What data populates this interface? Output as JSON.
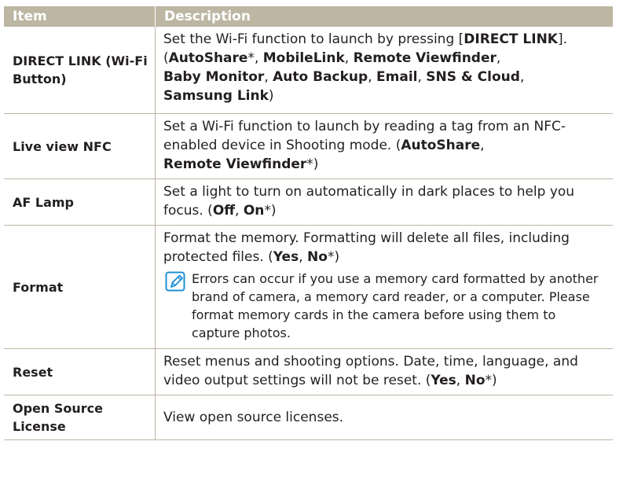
{
  "header": {
    "item": "Item",
    "description": "Description"
  },
  "rows": [
    {
      "item": "DIRECT LINK (Wi-Fi Button)",
      "desc": {
        "t1": "Set the Wi-Fi function to launch by pressing [",
        "b1": "DIRECT LINK",
        "t2": "]. (",
        "b2": "AutoShare",
        "t3": "*, ",
        "b3": "MobileLink",
        "t4": ", ",
        "b4": "Remote Viewfinder",
        "t5": ", ",
        "b5": "Baby Monitor",
        "t6": ", ",
        "b6": "Auto Backup",
        "t7": ", ",
        "b7": "Email",
        "t8": ", ",
        "b8": "SNS & Cloud",
        "t9": ", ",
        "b9": "Samsung Link",
        "t10": ")"
      }
    },
    {
      "item": "Live view NFC",
      "desc": {
        "t1": "Set a Wi-Fi function to launch by reading a tag from an NFC-enabled device in Shooting mode. (",
        "b1": "AutoShare",
        "t2": ", ",
        "b2": "Remote Viewfinder",
        "t3": "*)"
      }
    },
    {
      "item": "AF Lamp",
      "desc": {
        "t1": "Set a light to turn on automatically in dark places to help you focus. (",
        "b1": "Off",
        "t2": ", ",
        "b2": "On",
        "t3": "*)"
      }
    },
    {
      "item": "Format",
      "desc": {
        "t1": "Format the memory. Formatting will delete all files, including protected files. (",
        "b1": "Yes",
        "t2": ", ",
        "b2": "No",
        "t3": "*)"
      },
      "note": "Errors can occur if you use a memory card formatted by another brand of camera, a memory card reader, or a computer. Please format memory cards in the camera before using them to capture photos."
    },
    {
      "item": "Reset",
      "desc": {
        "t1": "Reset menus and shooting options. Date, time, language, and video output settings will not be reset. (",
        "b1": "Yes",
        "t2": ", ",
        "b2": "No",
        "t3": "*)"
      }
    },
    {
      "item": "Open Source License",
      "desc": {
        "t1": "View open source licenses."
      }
    }
  ],
  "icons": {
    "note": "note-pencil-icon"
  },
  "colors": {
    "header_bg": "#bcb6a3",
    "icon_blue": "#1e8fd5"
  }
}
